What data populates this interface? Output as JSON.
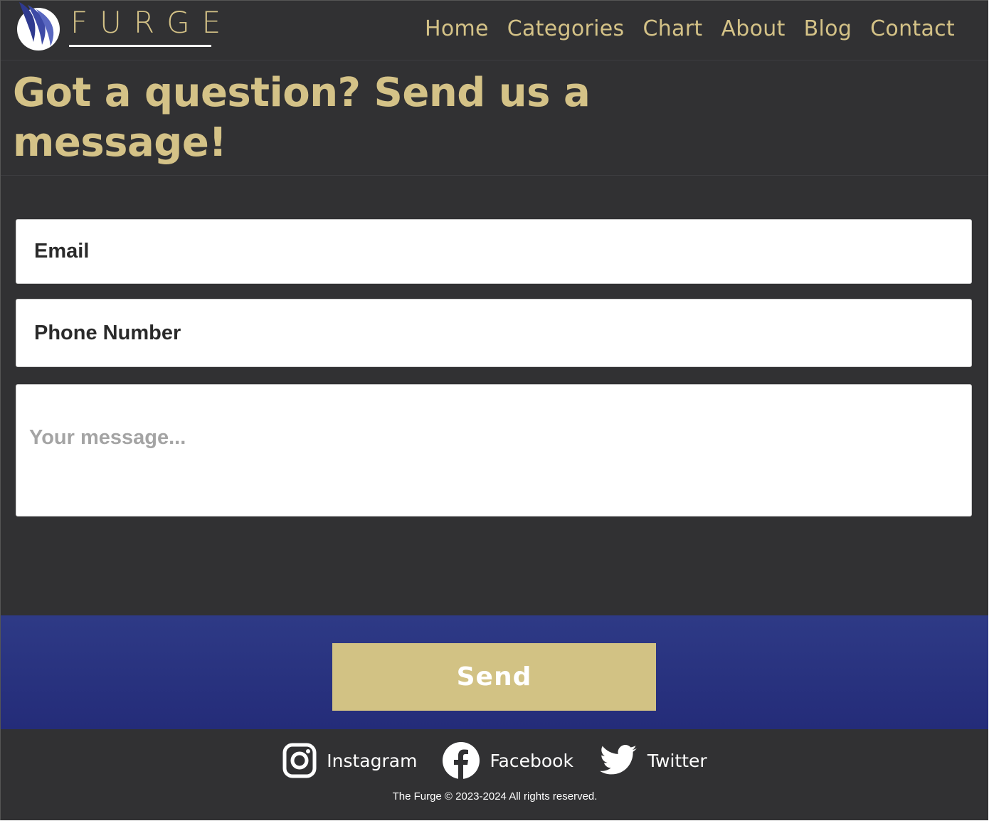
{
  "brand": {
    "name": "FURGE",
    "colors": {
      "gold": "#d4c287",
      "navy": "#2a3380",
      "background": "#313133"
    },
    "logo_icon": "feather-circle-logo-icon"
  },
  "nav": {
    "items": [
      "Home",
      "Categories",
      "Chart",
      "About",
      "Blog",
      "Contact"
    ]
  },
  "heading": "Got a question? Send us a message!",
  "form": {
    "email_placeholder": "Email",
    "phone_placeholder": "Phone Number",
    "message_placeholder": "Your message...",
    "send_label": "Send"
  },
  "footer": {
    "socials": [
      {
        "label": "Instagram",
        "icon": "instagram-icon"
      },
      {
        "label": "Facebook",
        "icon": "facebook-icon"
      },
      {
        "label": "Twitter",
        "icon": "twitter-icon"
      }
    ],
    "copyright": "The Furge © 2023-2024 All rights reserved."
  }
}
